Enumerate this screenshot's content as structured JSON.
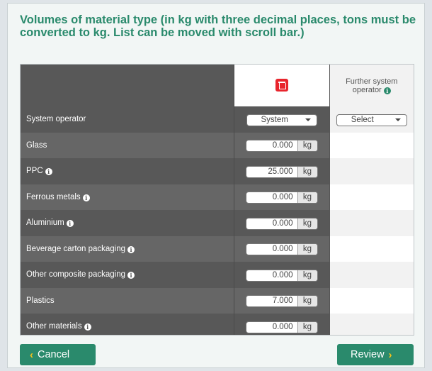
{
  "heading": "Volumes of material type (in kg with three decimal places, tons must be converted to kg. List can be moved with scroll bar.)",
  "table": {
    "further_operator_label": "Further system operator",
    "operator_row": {
      "label": "System operator",
      "selected": "System",
      "further_selected": "Select"
    },
    "unit": "kg",
    "materials": [
      {
        "label": "Glass",
        "value": "0.000",
        "info": false
      },
      {
        "label": "PPC",
        "value": "25.000",
        "info": true
      },
      {
        "label": "Ferrous metals",
        "value": "0.000",
        "info": true
      },
      {
        "label": "Aluminium",
        "value": "0.000",
        "info": true
      },
      {
        "label": "Beverage carton packaging",
        "value": "0.000",
        "info": true
      },
      {
        "label": "Other composite packaging",
        "value": "0.000",
        "info": true
      },
      {
        "label": "Plastics",
        "value": "7.000",
        "info": false
      },
      {
        "label": "Other materials",
        "value": "0.000",
        "info": true
      }
    ]
  },
  "buttons": {
    "cancel": "Cancel",
    "review": "Review"
  },
  "icons": {
    "delete": "trash-icon",
    "info": "info-icon",
    "caret": "chevron-down-icon",
    "back": "chevron-left-icon",
    "next": "chevron-right-icon"
  },
  "colors": {
    "brand": "#2a8a6c",
    "delete": "#e8252d",
    "chevron": "#f6c21b"
  }
}
